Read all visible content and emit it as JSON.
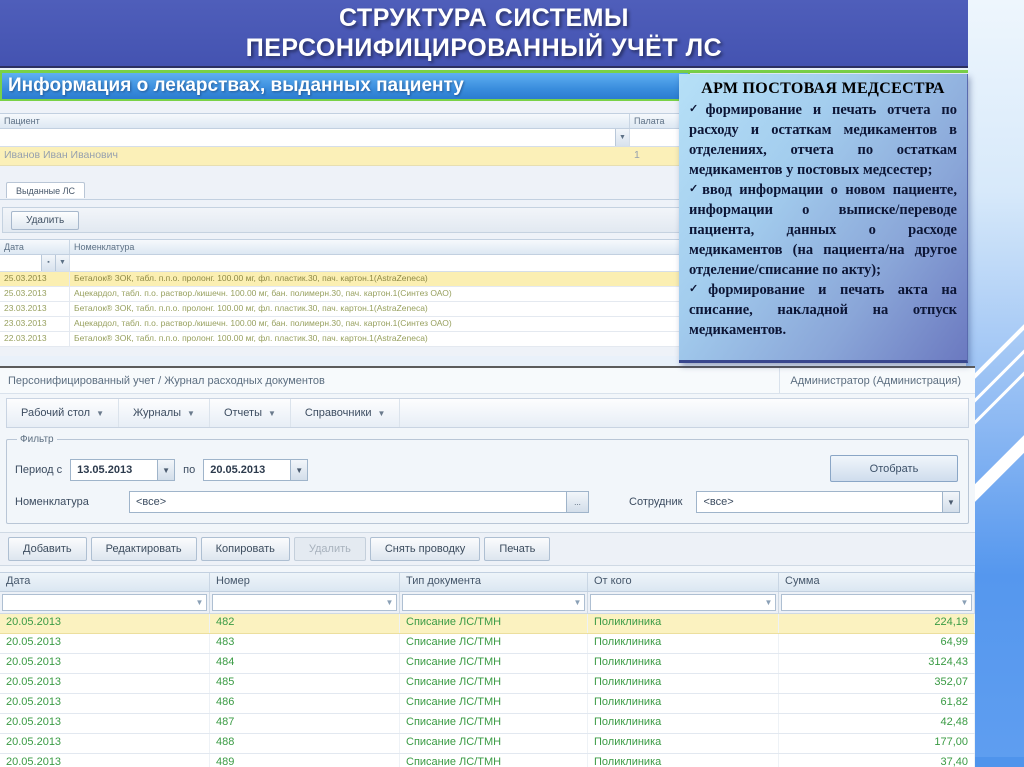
{
  "slide": {
    "title_line1": "СТРУКТУРА СИСТЕМЫ",
    "title_line2": "ПЕРСОНИФИЦИРОВАННЫЙ УЧЁТ ЛС"
  },
  "upper": {
    "window_title": "Информация о лекарствах,  выданных пациенту",
    "patient_table": {
      "col_patient": "Пациент",
      "col_ward": "Палата",
      "selected_patient": "Иванов Иван Иванович",
      "selected_ward": "1"
    },
    "tab_label": "Выданные ЛС",
    "delete_button": "Удалить",
    "drug_table": {
      "col_date": "Дата",
      "col_nomenclature": "Номенклатура",
      "rows": [
        {
          "date": "25.03.2013",
          "nomenclature": "Беталок® ЗОК, табл. п.п.о. пролонг. 100.00 мг, фл. пластик.30, пач. картон.1(AstraZeneca)",
          "highlighted": true
        },
        {
          "date": "25.03.2013",
          "nomenclature": "Ацекардол, табл. п.о. раствор./кишечн. 100.00 мг, бан. полимерн.30, пач. картон.1(Синтез ОАО)",
          "highlighted": false
        },
        {
          "date": "23.03.2013",
          "nomenclature": "Беталок® ЗОК, табл. п.п.о. пролонг. 100.00 мг, фл. пластик.30, пач. картон.1(AstraZeneca)",
          "highlighted": false
        },
        {
          "date": "23.03.2013",
          "nomenclature": "Ацекардол, табл. п.о. раствор./кишечн. 100.00 мг, бан. полимерн.30, пач. картон.1(Синтез ОАО)",
          "highlighted": false
        },
        {
          "date": "22.03.2013",
          "nomenclature": "Беталок® ЗОК, табл. п.п.о. пролонг. 100.00 мг, фл. пластик.30, пач. картон.1(AstraZeneca)",
          "highlighted": false
        }
      ]
    }
  },
  "panel": {
    "title": "АРМ ПОСТОВАЯ МЕДСЕСТРА",
    "check_glyph": "✓",
    "bullets": [
      "формирование и печать отчета по расходу и остаткам медикаментов в отделениях, отчета по остаткам медикаментов у постовых медсестер;",
      "ввод информации о новом пациенте, информации о выписке/переводе пациента, данных о расходе медикаментов (на пациента/на другое отделение/списание по акту);",
      "формирование и печать акта на списание, накладной на отпуск медикаментов."
    ]
  },
  "lower": {
    "breadcrumb": "Персонифицированный учет  /  Журнал расходных документов",
    "user_badge": "Администратор (Администрация)",
    "menu": [
      "Рабочий стол",
      "Журналы",
      "Отчеты",
      "Справочники"
    ],
    "dropdown_glyph": "▼",
    "filter": {
      "legend": "Фильтр",
      "period_from_label": "Период с",
      "period_from_value": "13.05.2013",
      "period_to_label": "по",
      "period_to_value": "20.05.2013",
      "select_button": "Отобрать",
      "nomenclature_label": "Номенклатура",
      "nomenclature_value": "<все>",
      "ellipsis_button": "...",
      "employee_label": "Сотрудник",
      "employee_value": "<все>"
    },
    "toolbar": [
      {
        "label": "Добавить",
        "enabled": true
      },
      {
        "label": "Редактировать",
        "enabled": true
      },
      {
        "label": "Копировать",
        "enabled": true
      },
      {
        "label": "Удалить",
        "enabled": false
      },
      {
        "label": "Снять проводку",
        "enabled": true
      },
      {
        "label": "Печать",
        "enabled": true
      }
    ],
    "table": {
      "columns": [
        "Дата",
        "Номер",
        "Тип документа",
        "От кого",
        "Сумма"
      ],
      "rows": [
        {
          "date": "20.05.2013",
          "number": "482",
          "doc_type": "Списание ЛС/ТМН",
          "from": "Поликлиника",
          "sum": "224,19",
          "highlighted": true
        },
        {
          "date": "20.05.2013",
          "number": "483",
          "doc_type": "Списание ЛС/ТМН",
          "from": "Поликлиника",
          "sum": "64,99",
          "highlighted": false
        },
        {
          "date": "20.05.2013",
          "number": "484",
          "doc_type": "Списание ЛС/ТМН",
          "from": "Поликлиника",
          "sum": "3124,43",
          "highlighted": false
        },
        {
          "date": "20.05.2013",
          "number": "485",
          "doc_type": "Списание ЛС/ТМН",
          "from": "Поликлиника",
          "sum": "352,07",
          "highlighted": false
        },
        {
          "date": "20.05.2013",
          "number": "486",
          "doc_type": "Списание ЛС/ТМН",
          "from": "Поликлиника",
          "sum": "61,82",
          "highlighted": false
        },
        {
          "date": "20.05.2013",
          "number": "487",
          "doc_type": "Списание ЛС/ТМН",
          "from": "Поликлиника",
          "sum": "42,48",
          "highlighted": false
        },
        {
          "date": "20.05.2013",
          "number": "488",
          "doc_type": "Списание ЛС/ТМН",
          "from": "Поликлиника",
          "sum": "177,00",
          "highlighted": false
        },
        {
          "date": "20.05.2013",
          "number": "489",
          "doc_type": "Списание ЛС/ТМН",
          "from": "Поликлиника",
          "sum": "37,40",
          "highlighted": false
        }
      ]
    }
  },
  "colors": {
    "header_blue": "#4453b1",
    "accent_green": "#79d147",
    "highlight_yellow": "#fbf0b8",
    "row_text_green": "#3a9b44",
    "strip_blue": "#5597ee",
    "title_bar_blue": "#2b7cd0"
  }
}
